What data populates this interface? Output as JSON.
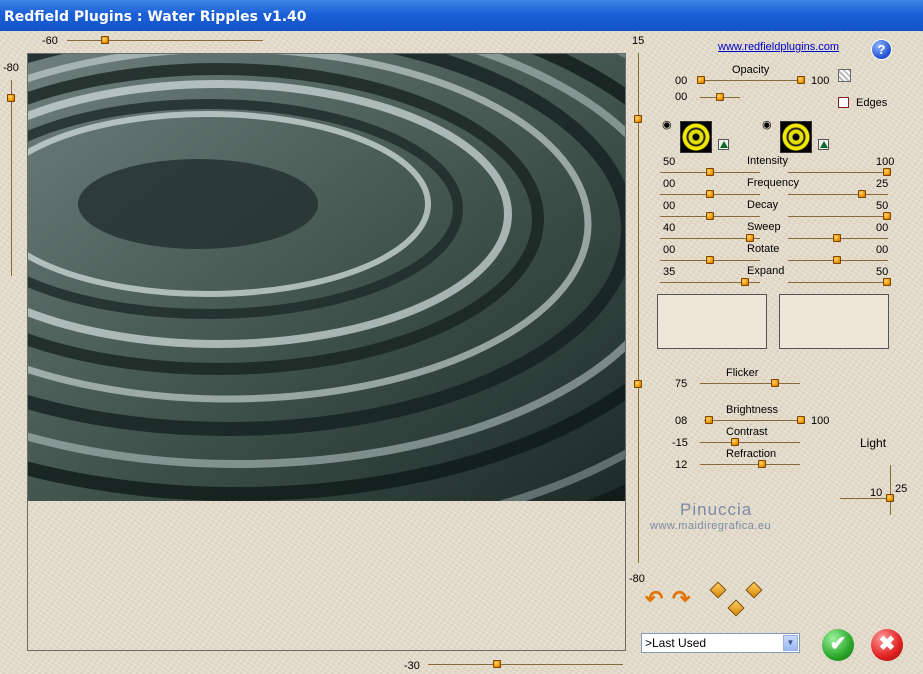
{
  "window": {
    "title": "Redfield Plugins : Water Ripples v1.40"
  },
  "header": {
    "link": "www.redfieldplugins.com",
    "help_icon": "?"
  },
  "preview": {
    "top_slider_value": "-60",
    "left_slider_value": "-80",
    "right_slider_top_value": "15",
    "right_slider_bottom_value": "-80",
    "bottom_slider_value": "-30"
  },
  "opacity": {
    "label": "Opacity",
    "left": "00",
    "right": "100",
    "second_value": "00"
  },
  "edges": {
    "label": "Edges",
    "checked": false
  },
  "ripple_params": [
    {
      "label": "Intensity",
      "left": "50",
      "right": "100"
    },
    {
      "label": "Frequency",
      "left": "00",
      "right": "25"
    },
    {
      "label": "Decay",
      "left": "00",
      "right": "50"
    },
    {
      "label": "Sweep",
      "left": "40",
      "right": "00"
    },
    {
      "label": "Rotate",
      "left": "00",
      "right": "00"
    },
    {
      "label": "Expand",
      "left": "35",
      "right": "50"
    }
  ],
  "light": {
    "flicker": {
      "label": "Flicker",
      "value": "75"
    },
    "brightness": {
      "label": "Brightness",
      "left": "08",
      "right": "100"
    },
    "contrast": {
      "label": "Contrast",
      "value": "-15"
    },
    "refraction": {
      "label": "Refraction",
      "value": "12"
    },
    "light_label": "Light",
    "light_v_value": "25",
    "light_h_value": "10"
  },
  "watermark": {
    "name": "Pinuccia",
    "site": "www.maidiregrafica.eu"
  },
  "footer": {
    "preset_select": ">Last Used",
    "ok_icon": "check-icon",
    "cancel_icon": "close-icon"
  },
  "colors": {
    "titlebar": "#1b5fd8",
    "knob": "#f29b00",
    "ok": "#2aa72a",
    "cancel": "#e02020",
    "water": "#4d6260"
  }
}
